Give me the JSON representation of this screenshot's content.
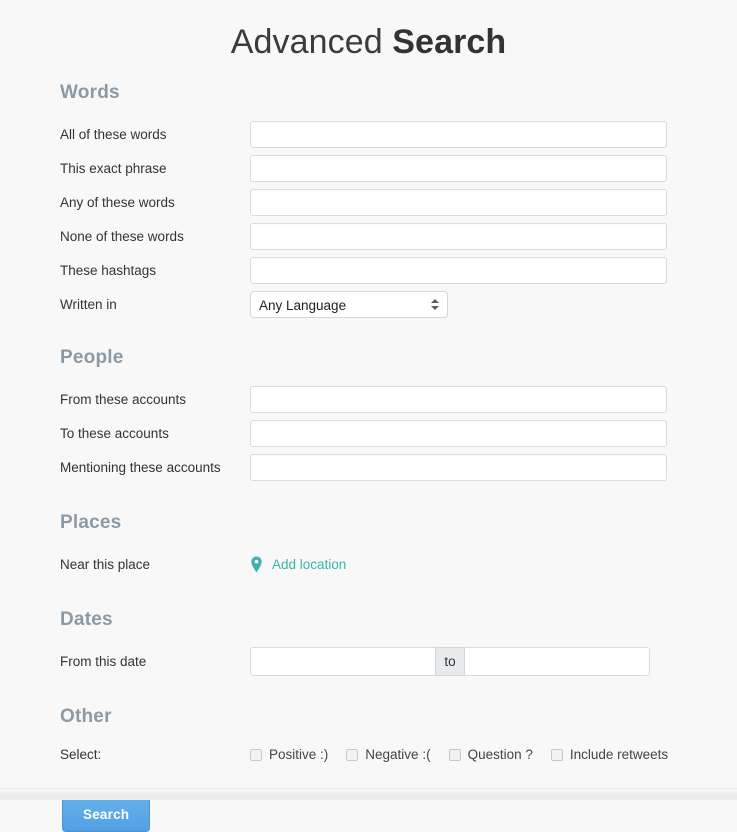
{
  "header": {
    "title_light": "Advanced",
    "title_bold": "Search"
  },
  "sections": {
    "words": {
      "heading": "Words",
      "fields": [
        {
          "label": "All of these words",
          "value": "",
          "placeholder": ""
        },
        {
          "label": "This exact phrase",
          "value": "",
          "placeholder": ""
        },
        {
          "label": "Any of these words",
          "value": "",
          "placeholder": ""
        },
        {
          "label": "None of these words",
          "value": "",
          "placeholder": ""
        },
        {
          "label": "These hashtags",
          "value": "",
          "placeholder": ""
        }
      ],
      "language": {
        "label": "Written in",
        "selected": "Any Language",
        "options": [
          "Any Language"
        ]
      }
    },
    "people": {
      "heading": "People",
      "fields": [
        {
          "label": "From these accounts",
          "value": "",
          "placeholder": ""
        },
        {
          "label": "To these accounts",
          "value": "",
          "placeholder": ""
        },
        {
          "label": "Mentioning these accounts",
          "value": "",
          "placeholder": ""
        }
      ]
    },
    "places": {
      "heading": "Places",
      "label": "Near this place",
      "link_text": "Add location",
      "link_icon": "map-pin-icon"
    },
    "dates": {
      "heading": "Dates",
      "label": "From this date",
      "from_value": "",
      "from_placeholder": "",
      "separator": "to",
      "to_value": "",
      "to_placeholder": ""
    },
    "other": {
      "heading": "Other",
      "label": "Select:",
      "checkboxes": [
        {
          "label": "Positive :)",
          "checked": false
        },
        {
          "label": "Negative :(",
          "checked": false
        },
        {
          "label": "Question ?",
          "checked": false
        },
        {
          "label": "Include retweets",
          "checked": false
        }
      ]
    }
  },
  "actions": {
    "submit_label": "Search"
  },
  "colors": {
    "page_background": "#f8f8f8",
    "heading": "#8c9aa6",
    "label": "#333333",
    "input_border": "#d4dde4",
    "link_teal": "#3bb3ad",
    "button_blue": "#5bacea",
    "button_text": "#ffffff"
  }
}
